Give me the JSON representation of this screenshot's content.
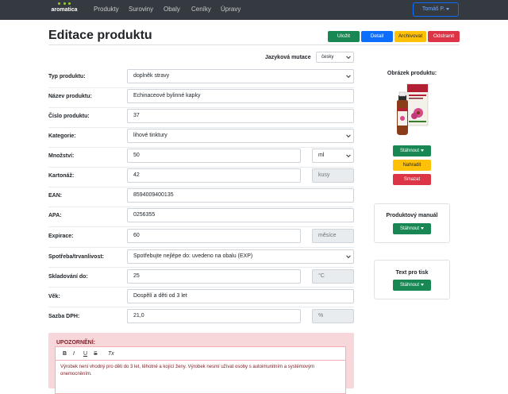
{
  "nav": {
    "brand": "aromatica",
    "items": [
      "Produkty",
      "Suroviny",
      "Obaly",
      "Ceníky",
      "Úpravy"
    ],
    "user": "Tomáš P."
  },
  "header": {
    "title": "Editace produktu",
    "buttons": {
      "save": "Uložit",
      "detail": "Detail",
      "archive": "Archivovat",
      "delete": "Odstranit"
    }
  },
  "lang": {
    "label": "Jazyková mutace",
    "value": "česky"
  },
  "form": {
    "type_label": "Typ produktu:",
    "type_value": "doplněk stravy",
    "name_label": "Název produktu:",
    "name_value": "Echinaceové bylinné kapky",
    "number_label": "Číslo produktu:",
    "number_value": "37",
    "category_label": "Kategorie:",
    "category_value": "lihové tinktury",
    "quantity_label": "Množství:",
    "quantity_value": "50",
    "quantity_unit": "ml",
    "carton_label": "Kartonáž:",
    "carton_value": "42",
    "carton_unit": "kusy",
    "ean_label": "EAN:",
    "ean_value": "8594009400135",
    "apa_label": "APA:",
    "apa_value": "0256355",
    "expiry_label": "Expirace:",
    "expiry_value": "60",
    "expiry_unit": "měsíce",
    "consume_label": "Spotřeba/trvanlivost:",
    "consume_value": "Spotřebujte nejlépe do: uvedeno na obalu (EXP)",
    "storage_label": "Skladování do:",
    "storage_value": "25",
    "storage_unit": "°C",
    "age_label": "Věk:",
    "age_value": "Dospělí a děti od 3 let",
    "vat_label": "Sazba DPH:",
    "vat_value": "21,0",
    "vat_unit": "%"
  },
  "warning": {
    "title": "UPOZORNĚNÍ:",
    "toolbar": [
      "B",
      "I",
      "U",
      "S",
      "Tx"
    ],
    "text": "Výrobek není vhodný pro děti do 3 let, těhotné a kojící ženy. Výrobek nesmí užívat osoby s autoimunitním a systémovým onemocněním."
  },
  "sidebar": {
    "image_title": "Obrázek produktu:",
    "download": "Stáhnout",
    "replace": "Nahradit",
    "remove": "Smazat",
    "manual_title": "Produktový manuál",
    "manual_download": "Stáhnout",
    "print_title": "Text pro tisk",
    "print_download": "Stáhnout"
  },
  "colors": {
    "green": "#198754",
    "blue": "#0d6efd",
    "yellow": "#ffc107",
    "red": "#dc3545",
    "navbar": "#343a40"
  }
}
